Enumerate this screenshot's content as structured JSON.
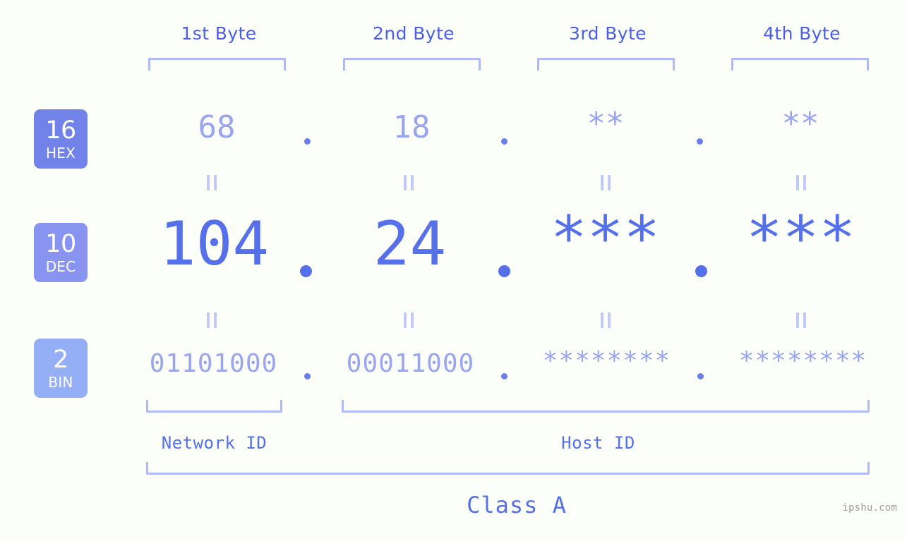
{
  "meta": {
    "watermark": "ipshu.com",
    "background_color": "#fcfefa",
    "accent_color": "#5670ea",
    "muted_accent_color": "#9aa5f0",
    "bracket_color": "#b0bbf5"
  },
  "header": {
    "byte_labels": [
      {
        "label": "1st Byte"
      },
      {
        "label": "2nd Byte"
      },
      {
        "label": "3rd Byte"
      },
      {
        "label": "4th Byte"
      }
    ]
  },
  "radix_badges": [
    {
      "number": "16",
      "name": "HEX",
      "color": "#7182e8"
    },
    {
      "number": "10",
      "name": "DEC",
      "color": "#8894ef"
    },
    {
      "number": "2",
      "name": "BIN",
      "color": "#94aff6"
    }
  ],
  "rows": {
    "hex": {
      "radix": "16",
      "radix_name": "HEX",
      "values": [
        "68",
        "18",
        "**",
        "**"
      ],
      "separator": "."
    },
    "dec": {
      "radix": "10",
      "radix_name": "DEC",
      "values": [
        "104",
        "24",
        "***",
        "***"
      ],
      "separator": "."
    },
    "bin": {
      "radix": "2",
      "radix_name": "BIN",
      "values": [
        "01101000",
        "00011000",
        "********",
        "********"
      ],
      "separator": "."
    }
  },
  "equals_marks": {
    "symbol": "=",
    "count_per_row": 4
  },
  "footer": {
    "network_id_label": "Network ID",
    "host_id_label": "Host ID",
    "class_label": "Class A"
  }
}
